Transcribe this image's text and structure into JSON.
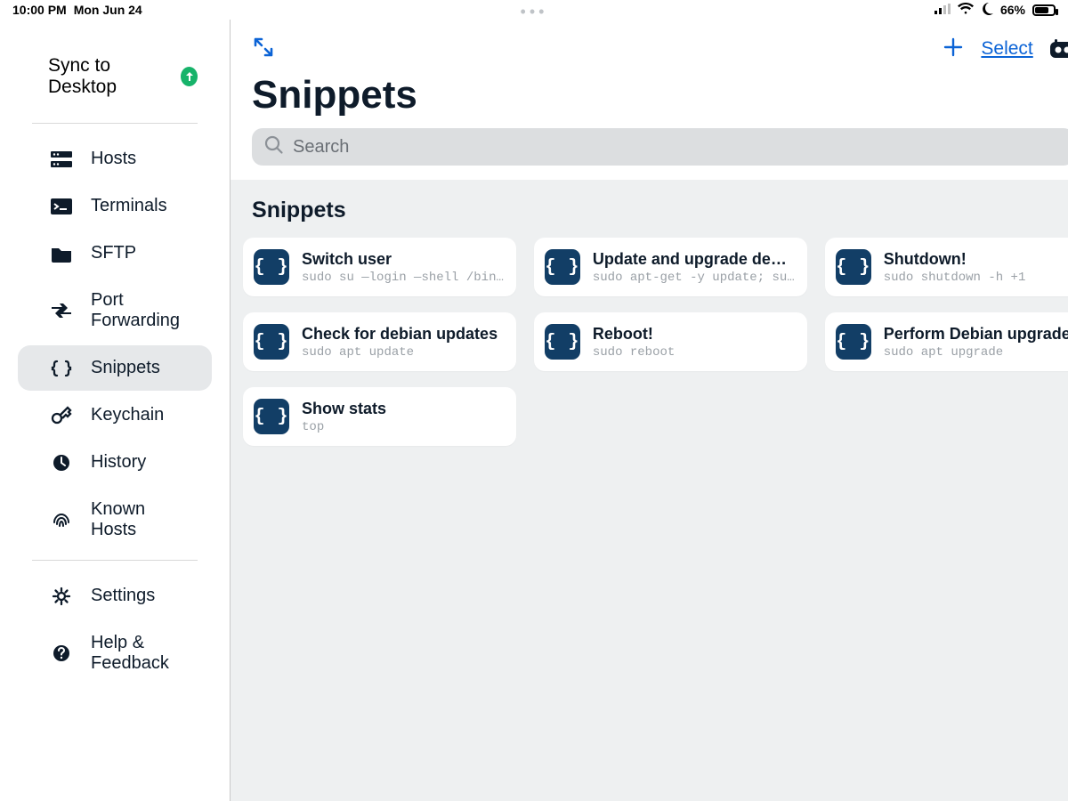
{
  "statusbar": {
    "time": "10:00 PM",
    "date": "Mon Jun 24",
    "battery_percent": "66%"
  },
  "sidebar": {
    "sync_label": "Sync to Desktop",
    "items": [
      {
        "label": "Hosts"
      },
      {
        "label": "Terminals"
      },
      {
        "label": "SFTP"
      },
      {
        "label": "Port Forwarding"
      },
      {
        "label": "Snippets"
      },
      {
        "label": "Keychain"
      },
      {
        "label": "History"
      },
      {
        "label": "Known Hosts"
      }
    ],
    "footer": [
      {
        "label": "Settings"
      },
      {
        "label": "Help & Feedback"
      }
    ],
    "active_index": 4
  },
  "header": {
    "title": "Snippets",
    "select_label": "Select",
    "search_placeholder": "Search"
  },
  "section": {
    "title": "Snippets"
  },
  "snippets": [
    {
      "title": "Switch user",
      "command": "sudo su —login —shell /bin…"
    },
    {
      "title": "Update and upgrade de…",
      "command": "sudo apt-get -y update; su…"
    },
    {
      "title": "Shutdown!",
      "command": "sudo shutdown -h +1"
    },
    {
      "title": "Check for debian updates",
      "command": "sudo apt update"
    },
    {
      "title": "Reboot!",
      "command": "sudo reboot"
    },
    {
      "title": "Perform Debian upgrade",
      "command": "sudo apt upgrade"
    },
    {
      "title": "Show stats",
      "command": "top"
    }
  ]
}
